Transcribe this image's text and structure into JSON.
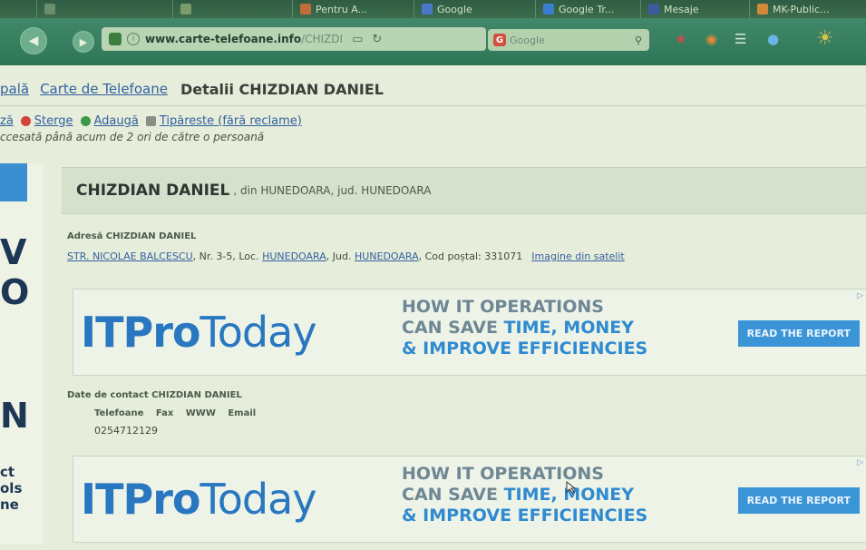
{
  "browser": {
    "tabs": [
      {
        "label": "",
        "color": "#6b8f6d"
      },
      {
        "label": "",
        "color": "#7a9b6b"
      },
      {
        "label": "Pentru A...",
        "color": "#c56b3a"
      },
      {
        "label": "Google",
        "color": "#4a78c9"
      },
      {
        "label": "Google Tr...",
        "color": "#3a7ed0"
      },
      {
        "label": "Mesaje",
        "color": "#3b5aa0"
      },
      {
        "label": "MK-Public...",
        "color": "#d08a3a"
      }
    ],
    "url_domain": "www.carte-telefoane.info",
    "url_path": "/CHIZDI",
    "search_placeholder": "Google",
    "icons": [
      "back-icon",
      "forward-icon",
      "reader-icon",
      "reload-icon",
      "search-icon",
      "bookmark-icon",
      "menu-icon"
    ]
  },
  "breadcrumb": {
    "home": "pală",
    "section": "Carte de Telefoane"
  },
  "page_title": "Detalii CHIZDIAN DANIEL",
  "actions": [
    {
      "label": "ză",
      "color": ""
    },
    {
      "label": "Sterge",
      "color": "#d2433a"
    },
    {
      "label": "Adaugă",
      "color": "#3a9a48"
    },
    {
      "label": "Tipăreste (fără reclame)",
      "color": "#8a8f86"
    }
  ],
  "visits_text": "ccesată până acum de 2 ori de către o persoană",
  "person": {
    "name": "CHIZDIAN DANIEL",
    "location": ", din HUNEDOARA, jud. HUNEDOARA"
  },
  "address": {
    "label": "Adresă CHIZDIAN DANIEL",
    "street": "STR. NICOLAE BALCESCU",
    "nr_text": ", Nr. 3-5, Loc. ",
    "city": "HUNEDOARA",
    "county_text": ", Jud. ",
    "county": "HUNEDOARA",
    "postal_text": ", Cod poștal: 331071",
    "satellite_link": "Imagine din satelit"
  },
  "ad": {
    "logo_bold": "ITPro",
    "logo_thin": "Today",
    "line1": "HOW IT OPERATIONS",
    "line2a": "CAN SAVE ",
    "line2b": "TIME, MONEY",
    "line3": "& IMPROVE EFFICIENCIES",
    "cta": "READ THE REPORT"
  },
  "contact": {
    "label": "Date de contact CHIZDIAN DANIEL",
    "headers": "Telefoane Fax WWW Email",
    "phone": "0254712129"
  },
  "sidebar_ad": {
    "letters": [
      "V",
      "O",
      "N"
    ],
    "lines": [
      "ct",
      "ols",
      "ne"
    ]
  }
}
